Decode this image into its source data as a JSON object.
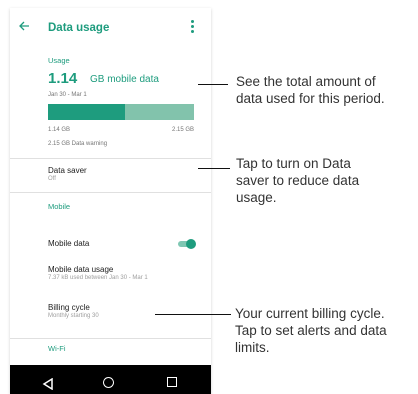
{
  "appbar": {
    "title": "Data usage",
    "back_icon": "arrow-back-icon",
    "menu_icon": "more-vert-icon"
  },
  "usage": {
    "section_label": "Usage",
    "amount": "1.14",
    "unit": "GB mobile data",
    "period": "Jan 30 - Mar 1",
    "bar_used_fraction": 0.53,
    "bar_left_label": "1.14 GB",
    "bar_right_label": "2.15 GB",
    "warning": "2.15 GB Data warning"
  },
  "data_saver": {
    "title": "Data saver",
    "subtitle": "Off"
  },
  "mobile": {
    "section_label": "Mobile",
    "mobile_data_label": "Mobile data",
    "mobile_data_on": true,
    "usage_title": "Mobile data usage",
    "usage_subtitle": "7.37 kB used between Jan 30 - Mar 1",
    "billing_title": "Billing cycle",
    "billing_subtitle": "Monthly starting 30"
  },
  "wifi": {
    "section_label": "Wi-Fi"
  },
  "navbar": {
    "back_icon": "nav-back-icon",
    "home_icon": "nav-home-icon",
    "recents_icon": "nav-recents-icon"
  },
  "callouts": {
    "total": [
      "See the total amount of",
      "data used for this period."
    ],
    "saver": [
      "Tap to turn on Data",
      "saver to reduce data",
      "usage."
    ],
    "billing": [
      "Your current billing cycle.",
      "Tap to set alerts and data",
      "limits."
    ]
  },
  "colors": {
    "accent": "#1e9c7e",
    "bar_remaining": "#82c3ac",
    "navbar": "#000000"
  }
}
